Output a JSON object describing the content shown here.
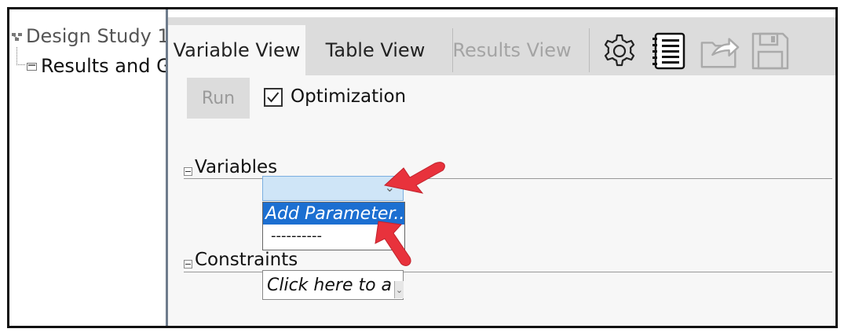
{
  "tree": {
    "items": [
      {
        "label": "Design Study 1",
        "icon": "design-study-icon"
      },
      {
        "label": "Results and G",
        "icon": "results-icon"
      }
    ]
  },
  "tabs": [
    {
      "label": "Variable View",
      "state": "active"
    },
    {
      "label": "Table View",
      "state": "normal"
    },
    {
      "label": "Results View",
      "state": "disabled"
    }
  ],
  "toolbar_icons": [
    "gear-icon",
    "notebook-icon",
    "export-folder-icon",
    "save-disk-icon"
  ],
  "run_label": "Run",
  "optimization": {
    "label": "Optimization",
    "checked": true
  },
  "sections": {
    "variables": "Variables",
    "constraints": "Constraints"
  },
  "variables_dropdown": {
    "options": [
      "Add Parameter...",
      "----------"
    ],
    "selected": "Add Parameter..."
  },
  "constraints_combo": {
    "text": "Click here to a"
  },
  "colors": {
    "selection": "#1c6fd1",
    "combo_bg": "#cfe5f7",
    "annotation_arrow": "#e8323c"
  }
}
